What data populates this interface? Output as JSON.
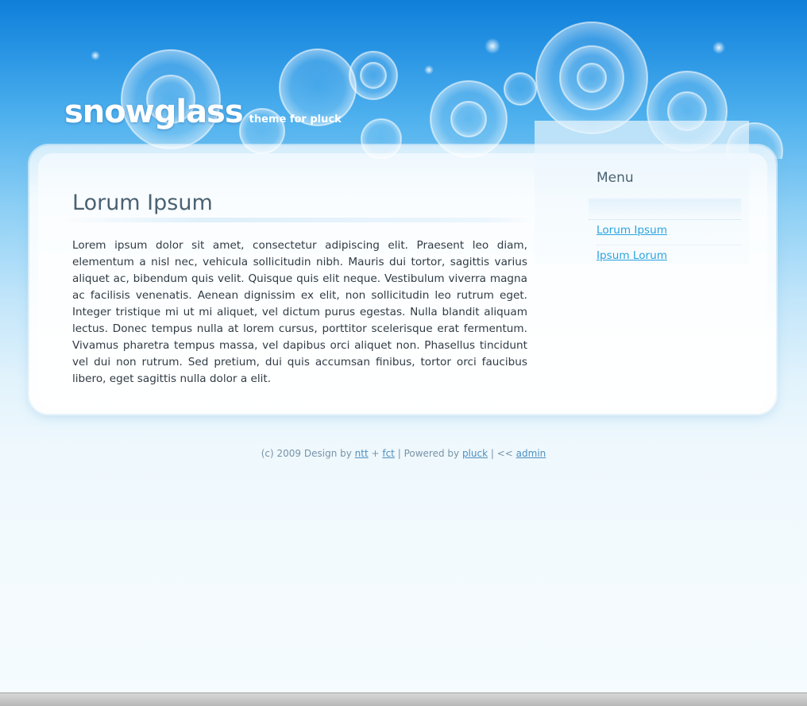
{
  "header": {
    "logo_title": "snowglass",
    "tagline": "theme for pluck"
  },
  "main": {
    "title": "Lorum Ipsum",
    "body": "Lorem ipsum dolor sit amet, consectetur adipiscing elit. Praesent leo diam, elementum a nisl nec, vehicula sollicitudin nibh. Mauris dui tortor, sagittis varius aliquet ac, bibendum quis velit. Quisque quis elit neque. Vestibulum viverra magna ac facilisis venenatis. Aenean dignissim ex elit, non sollicitudin leo rutrum eget. Integer tristique mi ut mi aliquet, vel dictum purus egestas. Nulla blandit aliquam lectus. Donec tempus nulla at lorem cursus, porttitor scelerisque erat fermentum. Vivamus pharetra tempus massa, vel dapibus orci aliquet non. Phasellus tincidunt vel dui non rutrum. Sed pretium, dui quis accumsan finibus, tortor orci faucibus libero, eget sagittis nulla dolor a elit."
  },
  "sidebar": {
    "title": "Menu",
    "items": [
      {
        "label": "Lorum Ipsum"
      },
      {
        "label": "Ipsum Lorum"
      }
    ]
  },
  "footer": {
    "prefix": "(c) 2009 Design by ",
    "link_ntt": "ntt",
    "plus": " + ",
    "link_fct": "fct",
    "powered": " | Powered by ",
    "link_pluck": "pluck",
    "sep": " | << ",
    "link_admin": "admin"
  },
  "colors": {
    "header_blue": "#1f8fe2",
    "link": "#2aa3e0",
    "heading": "#4a6272"
  }
}
